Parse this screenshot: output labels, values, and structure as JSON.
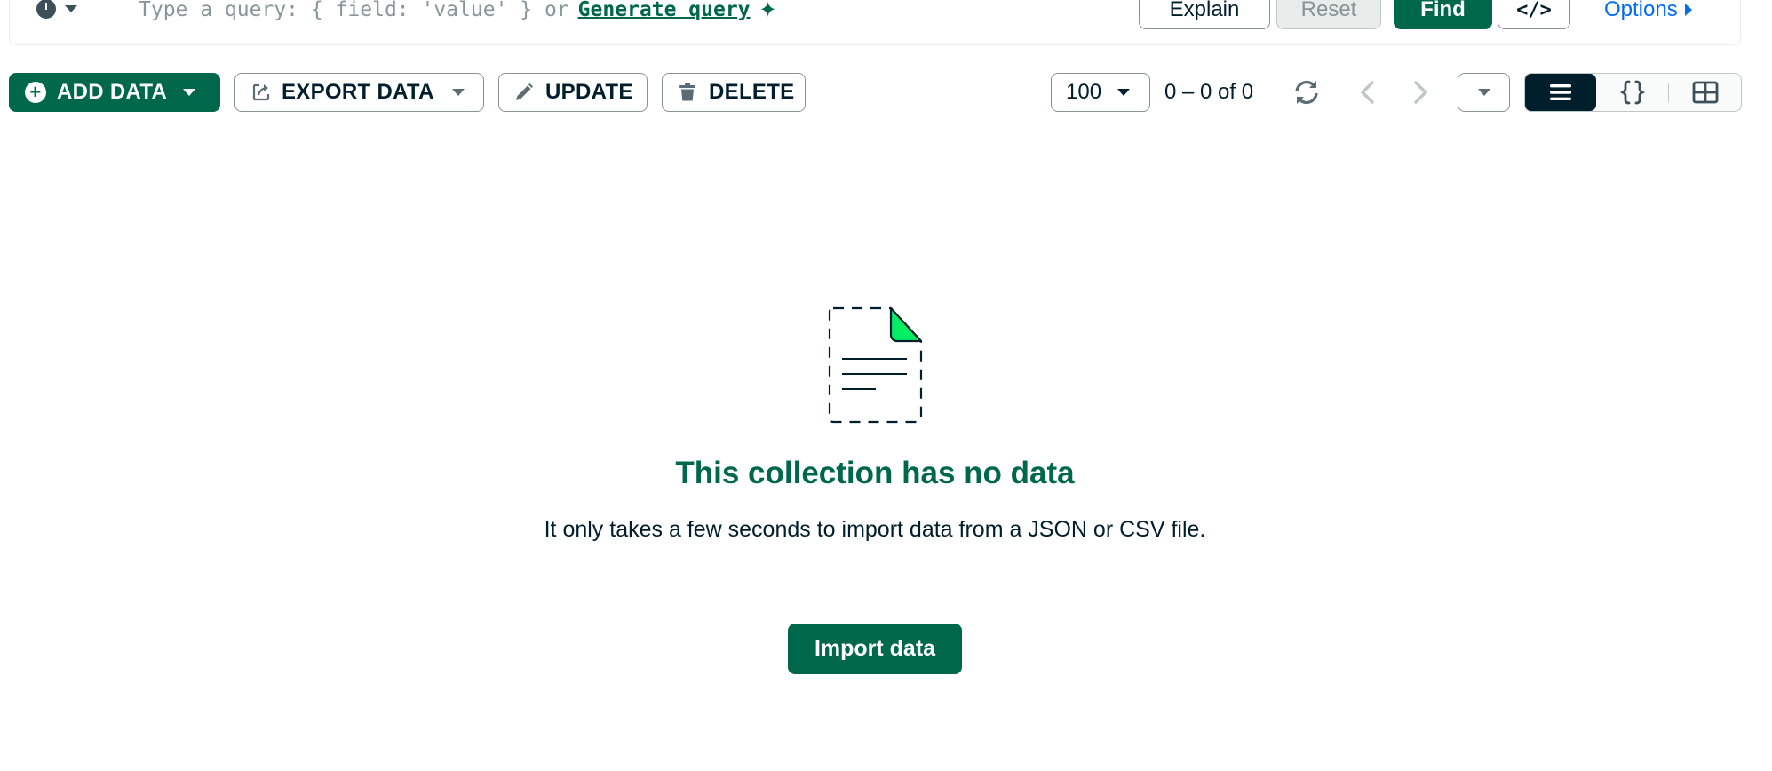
{
  "query_bar": {
    "placeholder_prefix": "Type a query: { field: 'value' } or",
    "generate_link": "Generate query",
    "explain_label": "Explain",
    "reset_label": "Reset",
    "find_label": "Find",
    "code_label": "</>",
    "options_label": "Options"
  },
  "toolbar": {
    "add_data_label": "ADD DATA",
    "export_data_label": "EXPORT DATA",
    "update_label": "UPDATE",
    "delete_label": "DELETE",
    "page_size": "100",
    "range_text": "0 – 0 of 0",
    "views": [
      "list",
      "json",
      "table"
    ],
    "active_view": "list"
  },
  "empty_state": {
    "title": "This collection has no data",
    "description": "It only takes a few seconds to import data from a JSON or CSV file.",
    "import_button": "Import data"
  },
  "icons": {
    "history": "clock-icon",
    "sparkle": "sparkle-icon",
    "add": "plus-circle-icon",
    "export": "export-icon",
    "update": "pencil-icon",
    "delete": "trash-icon",
    "refresh": "refresh-icon",
    "prev": "chevron-left-icon",
    "next": "chevron-right-icon",
    "list_view": "list-view-icon",
    "json_view": "json-view-icon",
    "table_view": "table-view-icon",
    "document": "empty-document-icon"
  },
  "colors": {
    "brand_green": "#00684A",
    "accent_green": "#00ED64",
    "link_blue": "#016BF8",
    "dark": "#001E2B",
    "border_gray": "#889397"
  }
}
